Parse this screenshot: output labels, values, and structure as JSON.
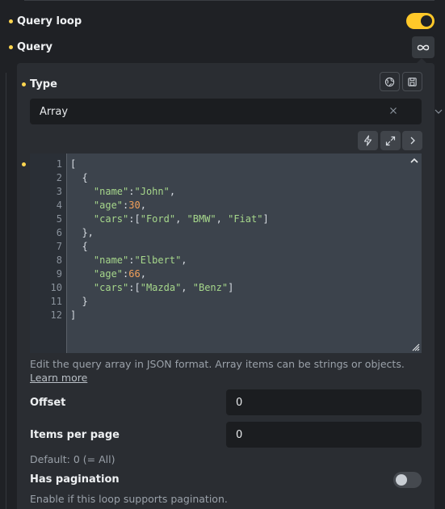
{
  "query_loop": {
    "label": "Query loop",
    "enabled": true
  },
  "query": {
    "label": "Query",
    "icon": "infinity-icon"
  },
  "type": {
    "label": "Type",
    "select_value": "Array",
    "icons": [
      "globe-icon",
      "save-icon"
    ]
  },
  "editor": {
    "toolbar_icons": [
      "bolt-icon",
      "expand-icon",
      "chevron-right-icon"
    ],
    "line_numbers": [
      "1",
      "2",
      "3",
      "4",
      "5",
      "6",
      "7",
      "8",
      "9",
      "10",
      "11",
      "12"
    ],
    "lines": [
      "[",
      "  {",
      "    \"name\":\"John\",",
      "    \"age\":30,",
      "    \"cars\":[\"Ford\", \"BMW\", \"Fiat\"]",
      "  },",
      "  {",
      "    \"name\":\"Elbert\",",
      "    \"age\":66,",
      "    \"cars\":[\"Mazda\", \"Benz\"]",
      "  }",
      "]"
    ]
  },
  "help": {
    "text": "Edit the query array in JSON format. Array items can be strings or objects. ",
    "link": "Learn more"
  },
  "offset": {
    "label": "Offset",
    "value": "0"
  },
  "items_per_page": {
    "label": "Items per page",
    "value": "0",
    "hint": "Default: 0 (= All)"
  },
  "pagination": {
    "label": "Has pagination",
    "enabled": false,
    "hint": "Enable if this loop supports pagination."
  },
  "colors": {
    "accent": "#ffc829",
    "panel": "#2a2d32",
    "editor": "#3c434c"
  }
}
